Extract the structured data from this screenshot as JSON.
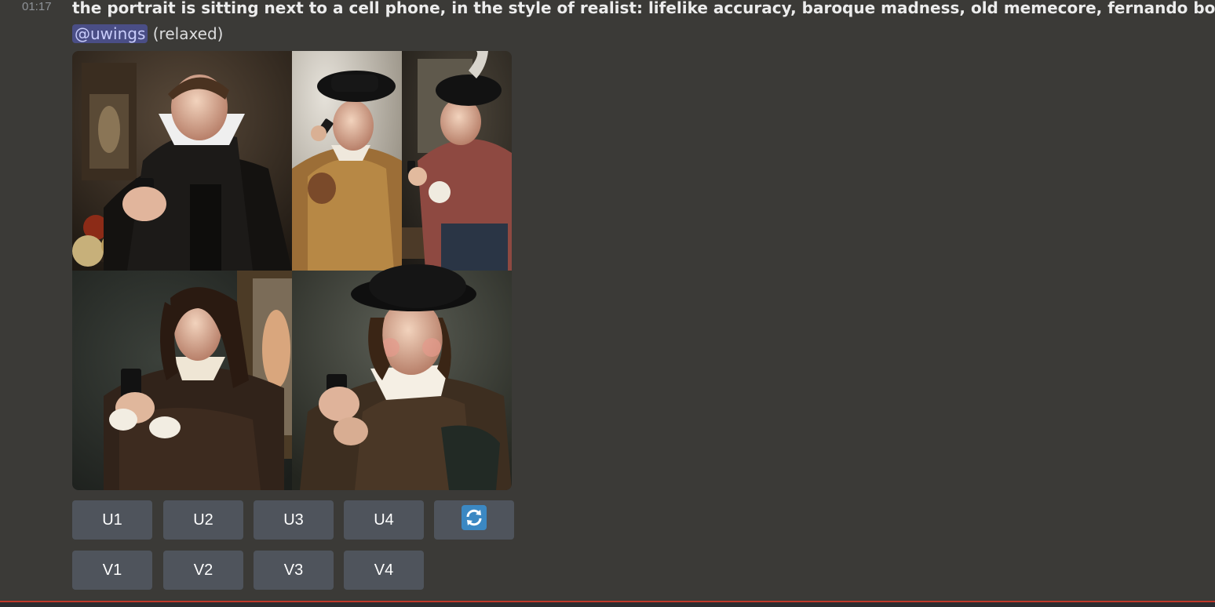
{
  "message": {
    "timestamp": "01:17",
    "prompt": "the portrait is sitting next to a cell phone, in the style of realist: lifelike accuracy, baroque madness, old memecore, fernando bote",
    "mention": "@uwings",
    "mode": "(relaxed)"
  },
  "image_grid": {
    "tiles": [
      "baroque-portrait-1",
      "baroque-portrait-2",
      "baroque-portrait-3",
      "baroque-portrait-4"
    ]
  },
  "buttons": {
    "upscale": [
      "U1",
      "U2",
      "U3",
      "U4"
    ],
    "variation": [
      "V1",
      "V2",
      "V3",
      "V4"
    ],
    "reroll_icon": "refresh-icon"
  },
  "colors": {
    "background": "#3b3a37",
    "button": "#4f545c",
    "mention_bg": "#4a4e86",
    "reroll_blue": "#3b88c3"
  }
}
